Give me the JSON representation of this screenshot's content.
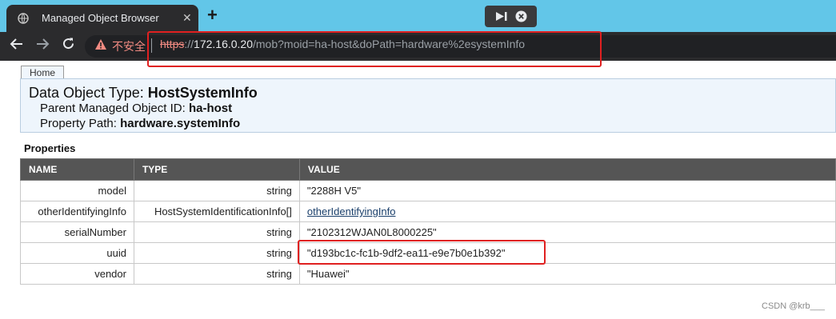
{
  "browser": {
    "tab_title": "Managed Object Browser",
    "tab_close": "✕",
    "new_tab": "+",
    "security_label": "不安全",
    "url_scheme": "https",
    "url_sep": "://",
    "url_host": "172.16.0.20",
    "url_rest": "/mob?moid=ha-host&doPath=hardware%2esystemInfo"
  },
  "page": {
    "home_tab": "Home",
    "data_object_type_label": "Data Object Type:",
    "data_object_type_value": "HostSystemInfo",
    "parent_label": "Parent Managed Object ID:",
    "parent_value": "ha-host",
    "path_label": "Property Path:",
    "path_value": "hardware.systemInfo",
    "properties_heading": "Properties"
  },
  "table": {
    "headers": [
      "NAME",
      "TYPE",
      "VALUE"
    ],
    "rows": [
      {
        "name": "model",
        "type": "string",
        "value": "\"2288H V5\""
      },
      {
        "name": "otherIdentifyingInfo",
        "type": "HostSystemIdentificationInfo[]",
        "value": "otherIdentifyingInfo"
      },
      {
        "name": "serialNumber",
        "type": "string",
        "value": "\"2102312WJAN0L8000225\""
      },
      {
        "name": "uuid",
        "type": "string",
        "value": "\"d193bc1c-fc1b-9df2-ea11-e9e7b0e1b392\""
      },
      {
        "name": "vendor",
        "type": "string",
        "value": "\"Huawei\""
      }
    ]
  },
  "watermark": "CSDN @krb___",
  "colors": {
    "tab_bar": "#62c6e8",
    "toolbar": "#2b2b2d",
    "header_bg": "#555555",
    "highlight": "#e02020"
  }
}
